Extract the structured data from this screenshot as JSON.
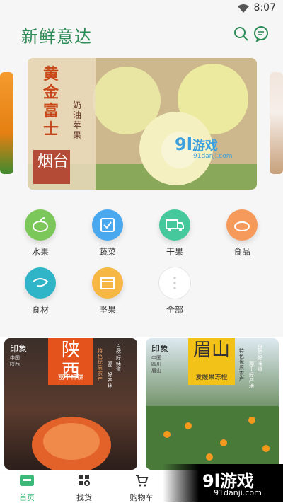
{
  "status": {
    "time": "8:07"
  },
  "header": {
    "logo": "新鲜意达"
  },
  "banner": {
    "main_title_1": "黄金富士",
    "main_title_2": "烟台",
    "main_sub": "奶油苹果",
    "watermark": "游戏",
    "watermark_url": "91danji.com"
  },
  "categories": [
    {
      "label": "水果",
      "color": "#7cc75a",
      "icon": "fruit-icon"
    },
    {
      "label": "蔬菜",
      "color": "#4aa8ef",
      "icon": "vegetable-icon"
    },
    {
      "label": "干果",
      "color": "#44c89c",
      "icon": "truck-icon"
    },
    {
      "label": "食品",
      "color": "#f59a5a",
      "icon": "food-icon"
    },
    {
      "label": "食材",
      "color": "#2fb4c8",
      "icon": "shrimp-icon"
    },
    {
      "label": "坚果",
      "color": "#f7b745",
      "icon": "box-icon"
    },
    {
      "label": "全部",
      "color": "#ffffff",
      "icon": "more-icon"
    }
  ],
  "products": [
    {
      "title": "陕西",
      "subtitle": "富平柿饼",
      "brand": "印象",
      "region": "中国 陕西",
      "side": "特色优质农产",
      "side2": "自然好味道",
      "side3": "源于好产地"
    },
    {
      "title": "眉山",
      "subtitle": "爱媛果冻橙",
      "brand": "印象",
      "region": "中国 四川眉山",
      "side": "特色优质农产",
      "side2": "自然好味道",
      "side3": "源于好产地"
    }
  ],
  "tabs": [
    {
      "label": "首页",
      "active": true
    },
    {
      "label": "找货",
      "active": false
    },
    {
      "label": "购物车",
      "active": false
    }
  ],
  "watermark": {
    "text": "游戏",
    "url": "91danji.com"
  }
}
